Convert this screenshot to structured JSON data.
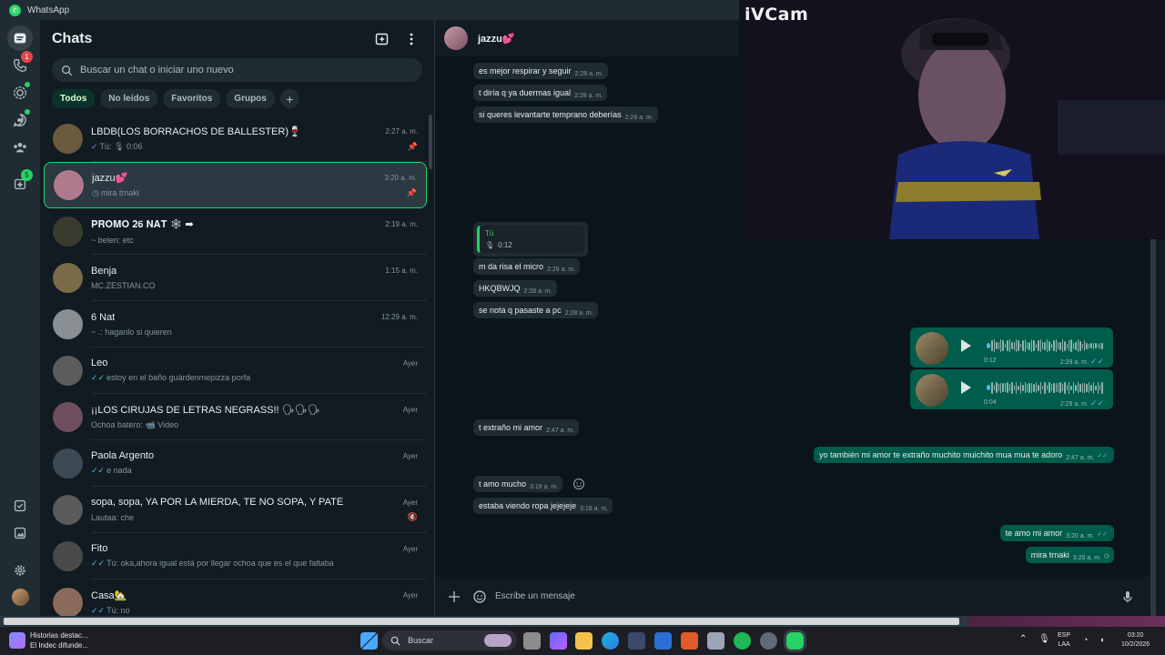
{
  "window": {
    "title": "WhatsApp"
  },
  "rail": {
    "calls_badge": "1",
    "communities_badge": "5"
  },
  "sidebar": {
    "title": "Chats",
    "search_placeholder": "Buscar un chat o iniciar uno nuevo",
    "filters": [
      "Todos",
      "No leídos",
      "Favoritos",
      "Grupos"
    ],
    "chats": [
      {
        "name": "LBDB(LOS BORRACHOS DE BALLESTER)🍷",
        "time": "2:27 a. m.",
        "tick": "✓",
        "preview_prefix": "Tú:",
        "preview": "🎙 0:06",
        "icon": "pin-icon",
        "avatar": "#6b5a3e"
      },
      {
        "name": "jazzu💕",
        "time": "3:20 a. m.",
        "tick": "◷",
        "preview_prefix": "",
        "preview": "mira trnaki",
        "icon": "pin-icon",
        "avatar": "#b07a8e",
        "selected": true
      },
      {
        "name": "𝐏𝐑𝐎𝐌𝐎 𝟐𝟔 𝐍𝐀𝐓 🕸 ➡",
        "time": "2:19 a. m.",
        "tick": "",
        "preview_prefix": "",
        "preview": "~ belen: etc",
        "icon": "",
        "avatar": "#3a3a2e"
      },
      {
        "name": "Benja",
        "time": "1:15 a. m.",
        "tick": "",
        "preview_prefix": "",
        "preview": "MC.ZESTIAN.CO",
        "icon": "",
        "avatar": "#7a6a48"
      },
      {
        "name": "6 Nat",
        "time": "12:29 a. m.",
        "tick": "",
        "preview_prefix": "",
        "preview": "~ .: haganlo si quieren",
        "icon": "",
        "avatar": "#8a8f94"
      },
      {
        "name": "Leo",
        "time": "Ayer",
        "tick": "✓✓",
        "preview_prefix": "",
        "preview": "estoy en el baño guárdenmepizza porfa",
        "icon": "",
        "avatar": "#5c5c5c"
      },
      {
        "name": "¡¡LOS CIRUJAS DE LETRAS NEGRASS!! 🗣🗣🗣",
        "time": "Ayer",
        "tick": "",
        "preview_prefix": "Ochoa batero:",
        "preview": "📹 Video",
        "icon": "",
        "avatar": "#6e4e5e"
      },
      {
        "name": "Paola Argento",
        "time": "Ayer",
        "tick": "✓✓",
        "preview_prefix": "",
        "preview": "e nada",
        "icon": "",
        "avatar": "#3b4a54"
      },
      {
        "name": "sopa, sopa, YA POR LA MIERDA, TE NO SOPA, Y PATÉ",
        "time": "Ayer",
        "tick": "",
        "preview_prefix": "",
        "preview": "Lautaa: che",
        "icon": "muted-icon",
        "avatar": "#5a5a5a"
      },
      {
        "name": "Fito",
        "time": "Ayer",
        "tick": "✓✓",
        "preview_prefix": "Tú:",
        "preview": "oka,ahora igual está por llegar ochoa que es el que faltaba",
        "icon": "",
        "avatar": "#4a4a4a"
      },
      {
        "name": "Casa🏡",
        "time": "Ayer",
        "tick": "✓✓",
        "preview_prefix": "Tú:",
        "preview": "no",
        "icon": "",
        "avatar": "#8a6a5a"
      }
    ]
  },
  "conversation": {
    "contact_name": "jazzu💕",
    "messages_in": [
      {
        "text": "es mejor respirar y seguir",
        "time": "2:28 a. m."
      },
      {
        "text": "t diría q ya duermas igual",
        "time": "2:28 a. m."
      },
      {
        "text": "si queres levantarte temprano deberías",
        "time": "2:28 a. m."
      },
      {
        "text": "m da risa el micro",
        "time": "2:28 a. m."
      },
      {
        "text": "HKQBWJQ",
        "time": "2:28 a. m."
      },
      {
        "text": "se nota q pasaste a pc",
        "time": "2:28 a. m."
      },
      {
        "text": "t extraño mi amor",
        "time": "2:47 a. m."
      },
      {
        "text": "t amo mucho",
        "time": "3:18 a. m."
      },
      {
        "text": "estaba viendo ropa jejejeje",
        "time": "3:18 a. m."
      }
    ],
    "reply_quote": {
      "name": "Tú",
      "audio": "0:12"
    },
    "voice_notes": [
      {
        "duration": "0:12",
        "time": "2:29 a. m.",
        "progress": 0.0
      },
      {
        "duration": "0:04",
        "time": "2:29 a. m.",
        "progress": 0.0
      }
    ],
    "messages_out": [
      {
        "text": "yo también mi amor te extraño muchito muichito mua mua te adoro",
        "time": "2:47 a. m."
      },
      {
        "text": "te amo mi amor",
        "time": "3:20 a. m."
      },
      {
        "text": "mira trnaki",
        "time": "3:20 a. m."
      }
    ],
    "composer_placeholder": "Escribe un mensaje"
  },
  "overlay": {
    "title": "iVCam"
  },
  "taskbar": {
    "news_title": "Historias destac...",
    "news_sub": "El Indec difunde...",
    "search_label": "Buscar",
    "lang": "ESP",
    "lang_sub": "LAA",
    "clock_time": "03:20",
    "clock_date": "10/2/2026"
  },
  "colors": {
    "accent": "#25d366",
    "outgoing": "#005c4b",
    "incoming": "#202c33",
    "background": "#0b141a"
  }
}
